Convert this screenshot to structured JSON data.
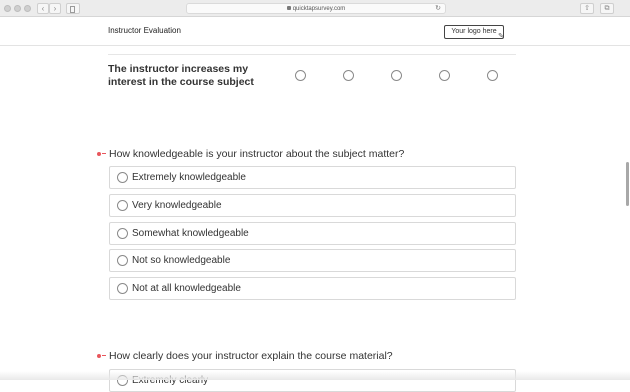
{
  "browser": {
    "url": "quicktapsurvey.com",
    "back_icon": "‹",
    "forward_icon": "›",
    "reload_icon": "↻",
    "share_icon": "⇧",
    "tabs_icon": "⧉"
  },
  "header": {
    "title": "Instructor Evaluation",
    "logo_placeholder": "Your logo here"
  },
  "matrix": {
    "statement": "The instructor increases my interest in the course subject",
    "options_count": 5
  },
  "questions": [
    {
      "title": "How knowledgeable is your instructor about the subject matter?",
      "options": [
        "Extremely knowledgeable",
        "Very knowledgeable",
        "Somewhat knowledgeable",
        "Not so knowledgeable",
        "Not at all knowledgeable"
      ]
    },
    {
      "title": "How clearly does your instructor explain the course material?",
      "options": [
        "Extremely clearly"
      ]
    }
  ],
  "colors": {
    "required_marker": "#e8565c",
    "border": "#d9d9d9"
  }
}
